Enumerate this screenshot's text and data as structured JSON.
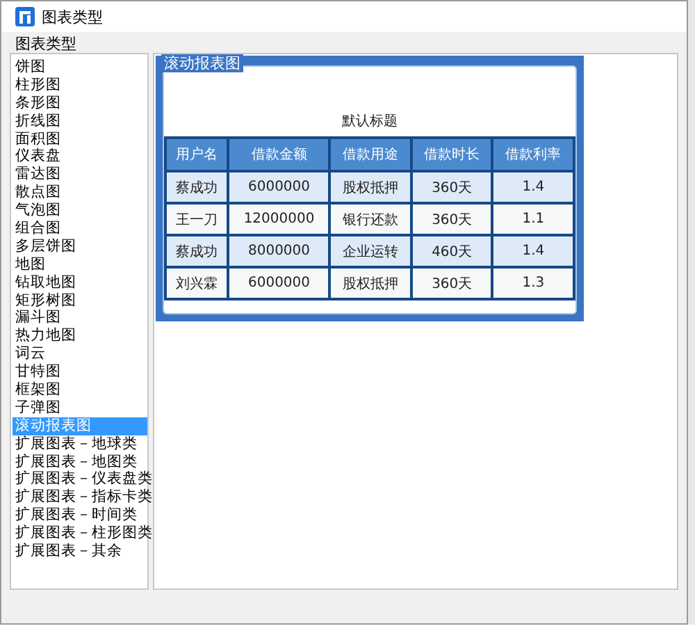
{
  "window": {
    "title": "图表类型"
  },
  "group_label": "图表类型",
  "chart_types": [
    {
      "label": "饼图",
      "selected": false
    },
    {
      "label": "柱形图",
      "selected": false
    },
    {
      "label": "条形图",
      "selected": false
    },
    {
      "label": "折线图",
      "selected": false
    },
    {
      "label": "面积图",
      "selected": false
    },
    {
      "label": "仪表盘",
      "selected": false
    },
    {
      "label": "雷达图",
      "selected": false
    },
    {
      "label": "散点图",
      "selected": false
    },
    {
      "label": "气泡图",
      "selected": false
    },
    {
      "label": "组合图",
      "selected": false
    },
    {
      "label": "多层饼图",
      "selected": false
    },
    {
      "label": "地图",
      "selected": false
    },
    {
      "label": "钻取地图",
      "selected": false
    },
    {
      "label": "矩形树图",
      "selected": false
    },
    {
      "label": "漏斗图",
      "selected": false
    },
    {
      "label": "热力地图",
      "selected": false
    },
    {
      "label": "词云",
      "selected": false
    },
    {
      "label": "甘特图",
      "selected": false
    },
    {
      "label": "框架图",
      "selected": false
    },
    {
      "label": "子弹图",
      "selected": false
    },
    {
      "label": "滚动报表图",
      "selected": true
    },
    {
      "label": "扩展图表－地球类",
      "selected": false
    },
    {
      "label": "扩展图表－地图类",
      "selected": false
    },
    {
      "label": "扩展图表－仪表盘类",
      "selected": false
    },
    {
      "label": "扩展图表－指标卡类",
      "selected": false
    },
    {
      "label": "扩展图表－时间类",
      "selected": false
    },
    {
      "label": "扩展图表－柱形图类",
      "selected": false
    },
    {
      "label": "扩展图表－其余",
      "selected": false
    }
  ],
  "preview": {
    "label": "滚动报表图",
    "title": "默认标题",
    "columns": [
      "用户名",
      "借款金额",
      "借款用途",
      "借款时长",
      "借款利率"
    ],
    "rows": [
      [
        "蔡成功",
        "6000000",
        "股权抵押",
        "360天",
        "1.4"
      ],
      [
        "王一刀",
        "12000000",
        "银行还款",
        "360天",
        "1.1"
      ],
      [
        "蔡成功",
        "8000000",
        "企业运转",
        "460天",
        "1.4"
      ],
      [
        "刘兴霖",
        "6000000",
        "股权抵押",
        "360天",
        "1.3"
      ]
    ]
  }
}
